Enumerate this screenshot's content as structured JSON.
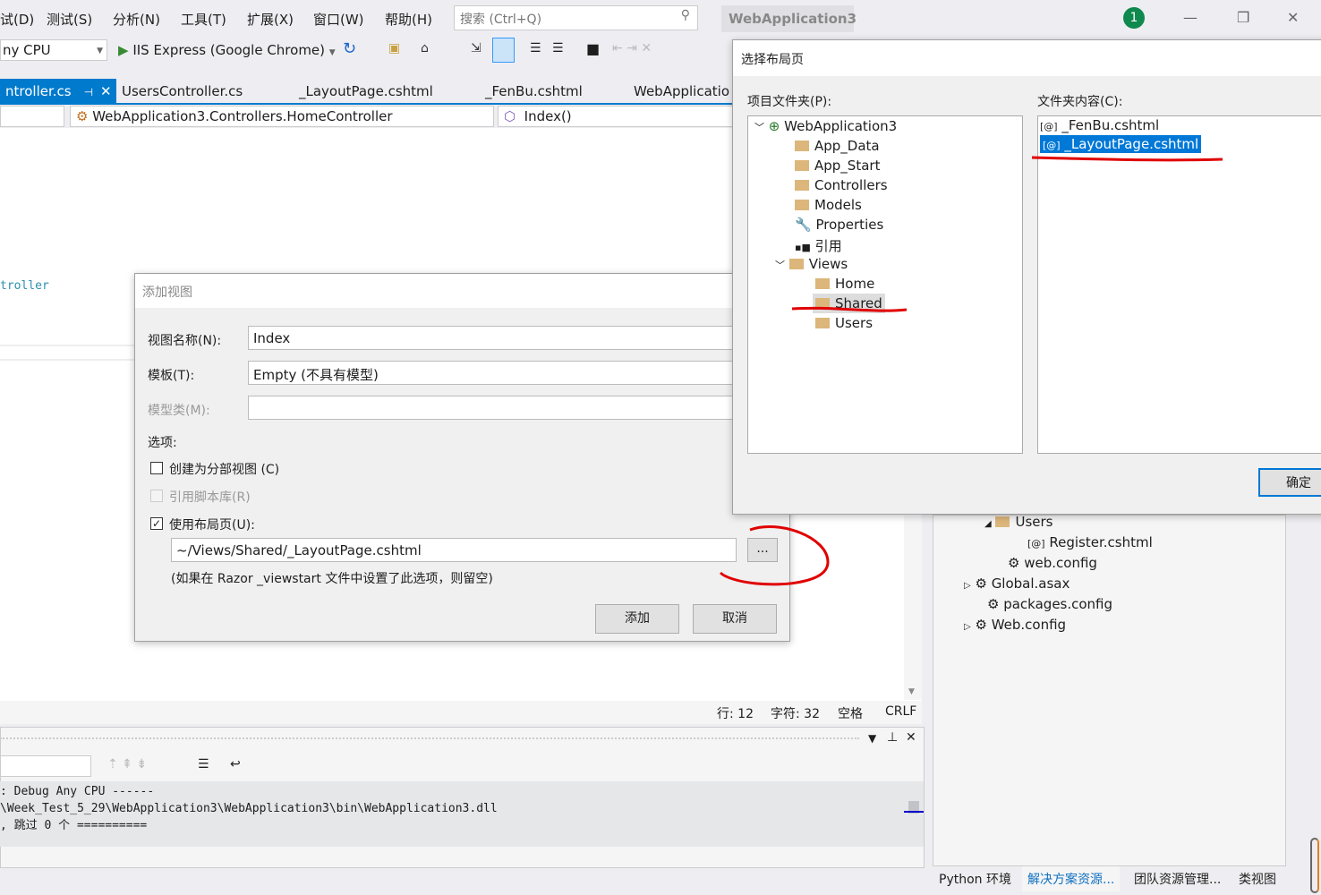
{
  "menu": {
    "items": [
      "试(D)",
      "测试(S)",
      "分析(N)",
      "工具(T)",
      "扩展(X)",
      "窗口(W)",
      "帮助(H)"
    ],
    "search_placeholder": "搜索 (Ctrl+Q)",
    "app_title": "WebApplication3",
    "notification_count": "1"
  },
  "toolbar": {
    "platform": "ny CPU",
    "run_target": "IIS Express (Google Chrome)"
  },
  "tabs": [
    "ntroller.cs",
    "UsersController.cs",
    "_LayoutPage.cshtml",
    "_FenBu.cshtml",
    "WebApplicatio"
  ],
  "navbar": {
    "class": "WebApplication3.Controllers.HomeController",
    "member": "Index()"
  },
  "editor": {
    "code_fragment": "troller"
  },
  "status": {
    "line": "行: 12",
    "char": "字符: 32",
    "space": "空格",
    "eol": "CRLF"
  },
  "output": {
    "lines": [
      ": Debug Any CPU ------",
      "\\Week_Test_5_29\\WebApplication3\\WebApplication3\\bin\\WebApplication3.dll",
      ", 跳过 0 个 =========="
    ]
  },
  "add_view": {
    "title": "添加视图",
    "name_label": "视图名称(N):",
    "name_value": "Index",
    "template_label": "模板(T):",
    "template_value": "Empty (不具有模型)",
    "model_label": "模型类(M):",
    "options_label": "选项:",
    "partial_label": "创建为分部视图 (C)",
    "scripts_label": "引用脚本库(R)",
    "layout_label": "使用布局页(U):",
    "layout_value": "~/Views/Shared/_LayoutPage.cshtml",
    "browse": "...",
    "hint": "(如果在 Razor _viewstart 文件中设置了此选项，则留空)",
    "add": "添加",
    "cancel": "取消"
  },
  "select_layout": {
    "title": "选择布局页",
    "folders_label": "项目文件夹(P):",
    "contents_label": "文件夹内容(C):",
    "tree": [
      "WebApplication3",
      "App_Data",
      "App_Start",
      "Controllers",
      "Models",
      "Properties",
      "引用",
      "Views",
      "Home",
      "Shared",
      "Users"
    ],
    "files": [
      "_FenBu.cshtml",
      "_LayoutPage.cshtml"
    ],
    "ok": "确定"
  },
  "solution_explorer": {
    "items": [
      "Users",
      "Register.cshtml",
      "web.config",
      "Global.asax",
      "packages.config",
      "Web.config"
    ],
    "bottom_tabs": [
      "Python 环境",
      "解决方案资源...",
      "团队资源管理...",
      "类视图"
    ]
  },
  "colors": {
    "accent": "#007acc",
    "annotation": "#e00000",
    "selection": "#0078d7"
  }
}
